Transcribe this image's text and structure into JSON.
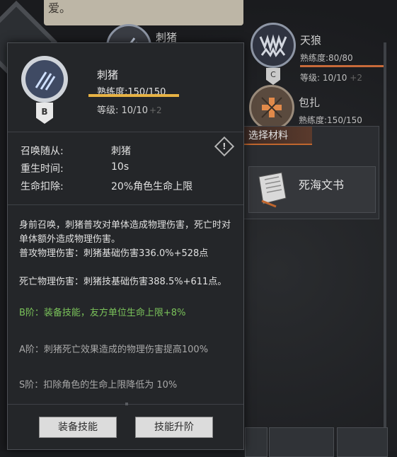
{
  "background": {
    "speech_text": "爱。",
    "skills": [
      {
        "name": "刺猪"
      },
      {
        "name": "天狼",
        "proficiency": "熟练度:80/80",
        "level": "等级: 10/10",
        "bonus": "+2",
        "grade": "C"
      },
      {
        "name": "包扎",
        "proficiency": "熟练度:150/150"
      }
    ],
    "material_panel": {
      "header": "选择材料",
      "item_label": "死海文书"
    }
  },
  "card": {
    "skill_name": "刺猪",
    "grade": "B",
    "proficiency": "熟练度:150/150",
    "proficiency_fraction": 1.0,
    "level": "等级: 10/10",
    "level_bonus": "+2",
    "attributes": [
      {
        "label": "召唤随从:",
        "value": "刺猪"
      },
      {
        "label": "重生时间:",
        "value": "10s"
      },
      {
        "label": "生命扣除:",
        "value": "20%角色生命上限"
      }
    ],
    "description": {
      "main": "身前召唤，刺猪普攻对单体造成物理伤害，死亡时对单体额外造成物理伤害。",
      "normal_attack": "普攻物理伤害：刺猪基础伤害336.0%+528点",
      "death_damage": "死亡物理伤害：刺猪技基础伤害388.5%+611点。",
      "tier_b": "B阶：装备技能，友方单位生命上限+8%",
      "tier_a": "A阶：刺猪死亡效果造成的物理伤害提高100%",
      "tier_s": "S阶：扣除角色的生命上限降低为 10%"
    },
    "buttons": {
      "equip": "装备技能",
      "upgrade": "技能升阶"
    }
  },
  "colors": {
    "proficiency_bar": "#e7b244",
    "tier_b_text": "#7ac25a",
    "material_accent": "#c0662e"
  }
}
